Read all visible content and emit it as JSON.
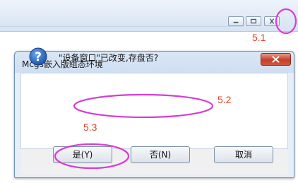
{
  "top_window": {
    "buttons": [
      {
        "name": "minimize",
        "icon": "minimize-icon"
      },
      {
        "name": "maximize",
        "icon": "maximize-icon"
      },
      {
        "name": "close",
        "icon": "close-icon"
      }
    ]
  },
  "annotations": {
    "close_label": "5.1",
    "message_label": "5.2",
    "icon_label": "5.3",
    "highlight_color": "#d63cd6",
    "label_color": "#e0442a"
  },
  "dialog": {
    "title": "Mcgs嵌入版组态环境",
    "close_icon": "close-icon",
    "icon": "question-icon",
    "message": "\"设备窗口\"已改变,存盘否?",
    "buttons": {
      "yes": "是(Y)",
      "no": "否(N)",
      "cancel": "取消"
    }
  }
}
